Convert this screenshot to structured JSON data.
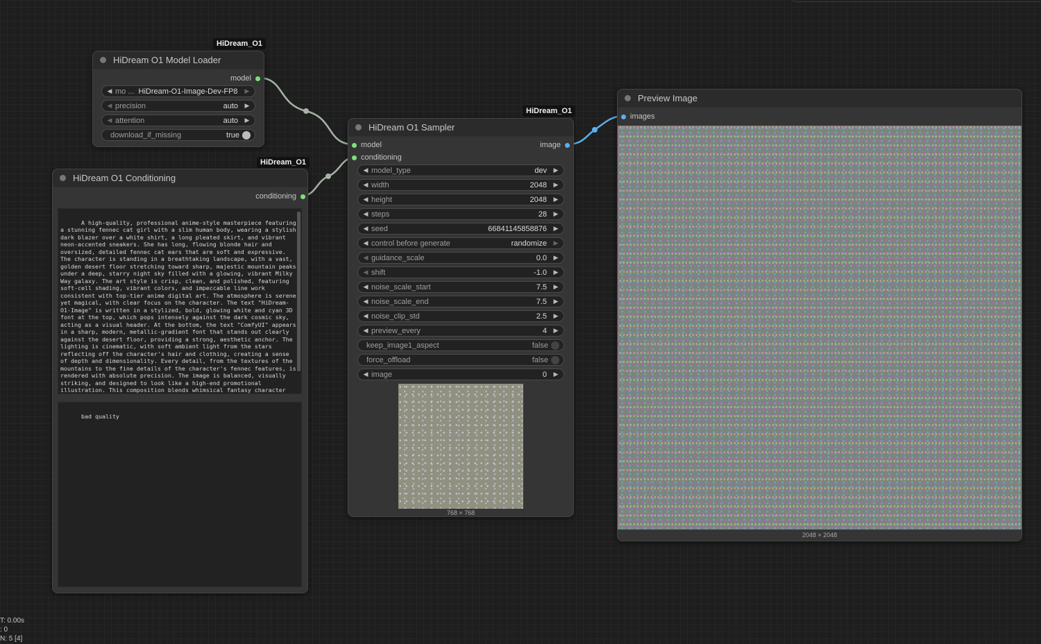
{
  "nodes": {
    "model_loader": {
      "badge": "HiDream_O1",
      "title": "HiDream O1 Model Loader",
      "output_model": "model",
      "widgets": {
        "model_name": {
          "label": "mo ...",
          "value": "HiDream-O1-Image-Dev-FP8"
        },
        "precision": {
          "label": "precision",
          "value": "auto"
        },
        "attention": {
          "label": "attention",
          "value": "auto"
        },
        "download_if_missing": {
          "label": "download_if_missing",
          "value": "true"
        }
      }
    },
    "conditioning": {
      "badge": "HiDream_O1",
      "title": "HiDream O1 Conditioning",
      "output_conditioning": "conditioning",
      "positive_prompt": "A high-quality, professional anime-style masterpiece featuring a stunning fennec cat girl with a slim human body, wearing a stylish dark blazer over a white shirt, a long pleated skirt, and vibrant neon-accented sneakers. She has long, flowing blonde hair and oversized, detailed fennec cat ears that are soft and expressive. The character is standing in a breathtaking landscape, with a vast, golden desert floor stretching toward sharp, majestic mountain peaks under a deep, starry night sky filled with a glowing, vibrant Milky Way galaxy. The art style is crisp, clean, and polished, featuring soft-cell shading, vibrant colors, and impeccable line work consistent with top-tier anime digital art. The atmosphere is serene yet magical, with clear focus on the character. The text \"HiDream-O1-Image\" is written in a stylized, bold, glowing white and cyan 3D font at the top, which pops intensely against the dark cosmic sky, acting as a visual header. At the bottom, the text \"ComfyUI\" appears in a sharp, modern, metallic-gradient font that stands out clearly against the desert floor, providing a strong, aesthetic anchor. The lighting is cinematic, with soft ambient light from the stars reflecting off the character's hair and clothing, creating a sense of depth and dimensionality. Every detail, from the textures of the mountains to the fine details of the character's fennec features, is rendered with absolute precision. The image is balanced, visually striking, and designed to look like a high-end promotional illustration. This composition blends whimsical fantasy character design with sleek, bold typography, ensuring that the text elements are legible, eye-catching,",
      "negative_prompt": "bad quality"
    },
    "sampler": {
      "badge": "HiDream_O1",
      "title": "HiDream O1 Sampler",
      "input_model": "model",
      "input_conditioning": "conditioning",
      "output_image": "image",
      "widgets": [
        {
          "label": "model_type",
          "value": "dev",
          "kind": "combo",
          "left_dim": false
        },
        {
          "label": "width",
          "value": "2048",
          "kind": "number",
          "left_dim": false
        },
        {
          "label": "height",
          "value": "2048",
          "kind": "number",
          "left_dim": false
        },
        {
          "label": "steps",
          "value": "28",
          "kind": "number",
          "left_dim": false
        },
        {
          "label": "seed",
          "value": "66841145858876",
          "kind": "number",
          "left_dim": false
        },
        {
          "label": "control before generate",
          "value": "randomize",
          "kind": "combo",
          "left_dim": false,
          "right_dim": true
        },
        {
          "label": "guidance_scale",
          "value": "0.0",
          "kind": "number",
          "left_dim": true
        },
        {
          "label": "shift",
          "value": "-1.0",
          "kind": "number",
          "left_dim": true
        },
        {
          "label": "noise_scale_start",
          "value": "7.5",
          "kind": "number",
          "left_dim": false
        },
        {
          "label": "noise_scale_end",
          "value": "7.5",
          "kind": "number",
          "left_dim": false
        },
        {
          "label": "noise_clip_std",
          "value": "2.5",
          "kind": "number",
          "left_dim": false
        },
        {
          "label": "preview_every",
          "value": "4",
          "kind": "number",
          "left_dim": false
        },
        {
          "label": "keep_image1_aspect",
          "value": "false",
          "kind": "toggle"
        },
        {
          "label": "force_offload",
          "value": "false",
          "kind": "toggle"
        },
        {
          "label": "image",
          "value": "0",
          "kind": "number",
          "left_dim": false
        }
      ],
      "preview_caption": "768 × 768"
    },
    "preview": {
      "title": "Preview Image",
      "input_images": "images",
      "caption": "2048 × 2048"
    }
  },
  "stats": {
    "line1": "T: 0.00s",
    "line2": ": 0",
    "line3": "N: 5 [4]"
  },
  "colors": {
    "model_link": "#a5b5a5",
    "conditioning_link": "#a5b5a5",
    "image_link": "#5ab0f0",
    "model_slot": "#7be27b",
    "image_slot": "#5ab0f0"
  }
}
